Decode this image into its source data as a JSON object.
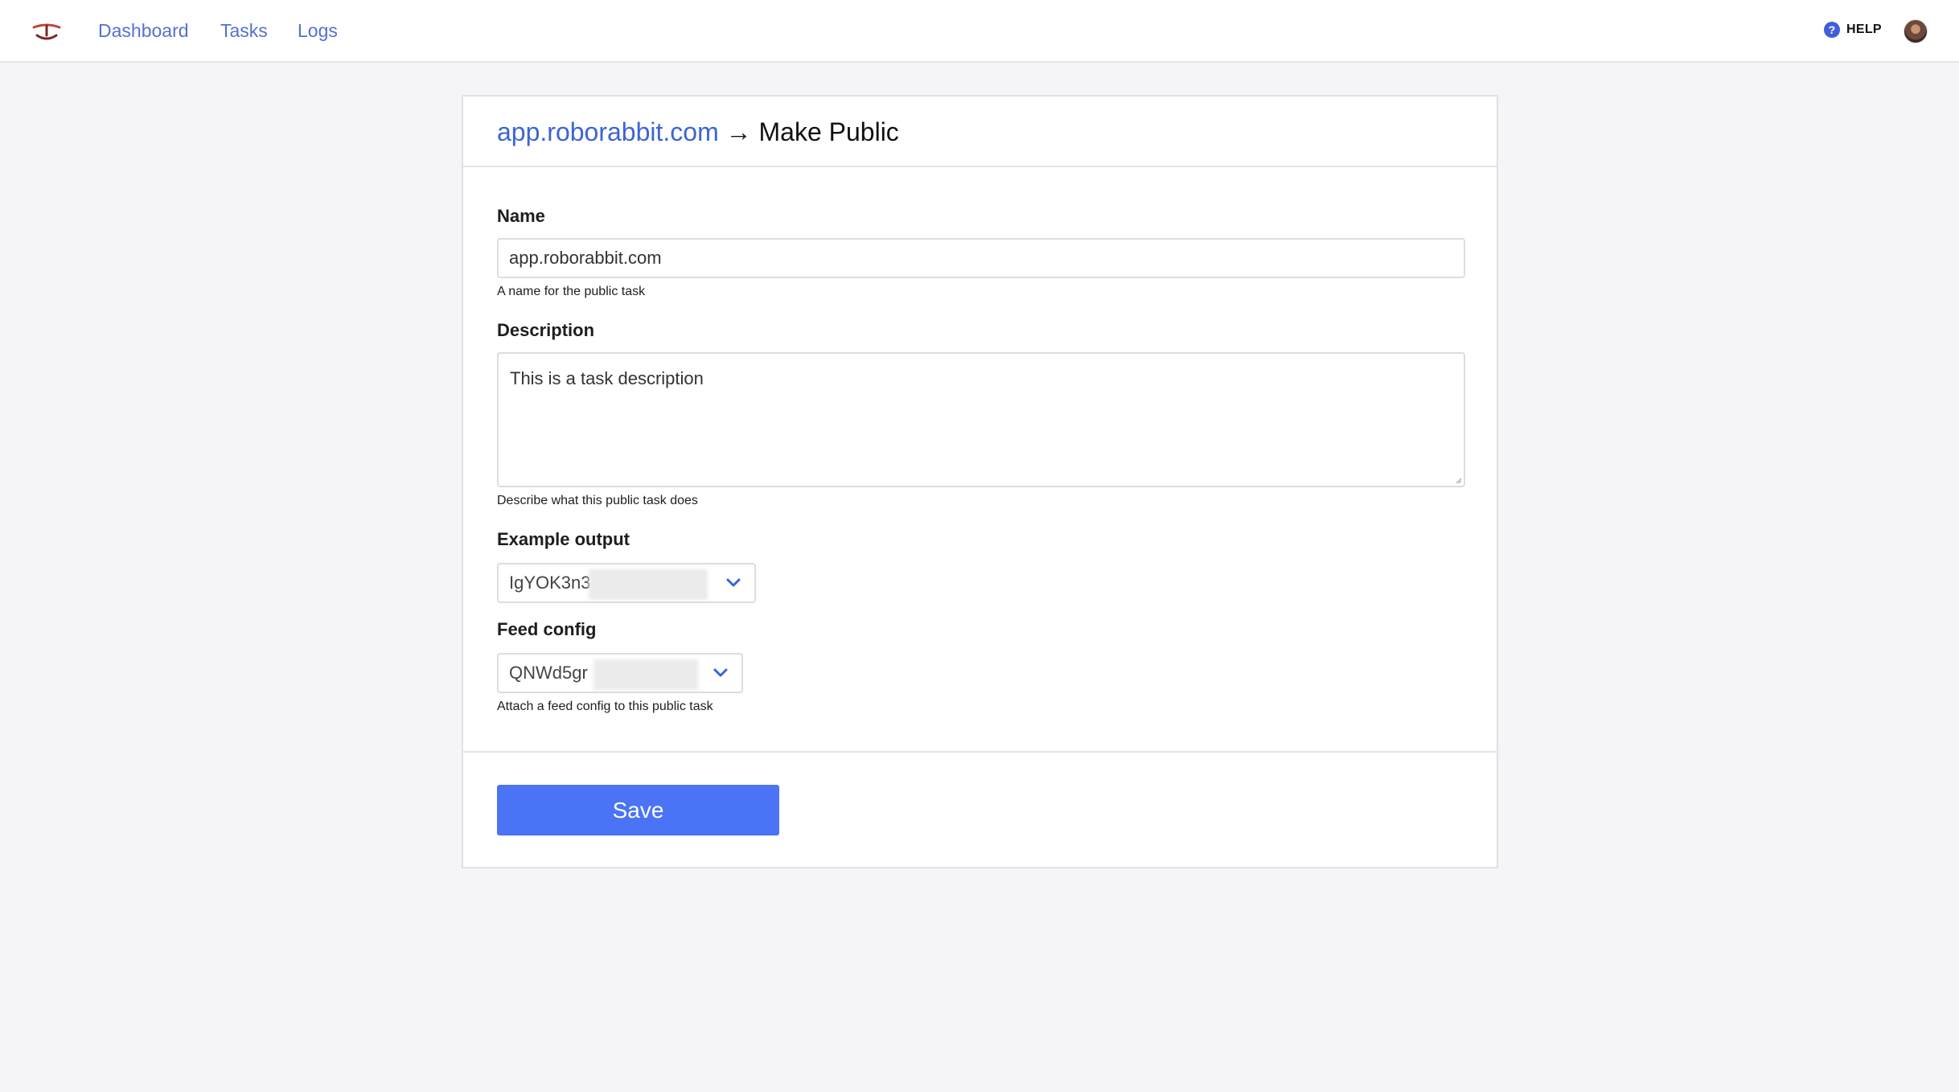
{
  "nav": {
    "logo_icon": "rabbit-logo-icon",
    "links": [
      {
        "label": "Dashboard"
      },
      {
        "label": "Tasks"
      },
      {
        "label": "Logs"
      }
    ],
    "help_label": "HELP",
    "help_icon": "question-circle-icon",
    "avatar_icon": "user-avatar"
  },
  "page": {
    "breadcrumb": "app.roborabbit.com",
    "arrow": "→",
    "title": "Make Public"
  },
  "form": {
    "name": {
      "label": "Name",
      "value": "app.roborabbit.com",
      "hint": "A name for the public task"
    },
    "description": {
      "label": "Description",
      "value": "This is a task description",
      "hint": "Describe what this public task does"
    },
    "example_output": {
      "label": "Example output",
      "selected": "IgYOK3n3"
    },
    "feed_config": {
      "label": "Feed config",
      "selected": "QNWd5gr",
      "hint": "Attach a feed config to this public task"
    },
    "save_label": "Save"
  },
  "colors": {
    "accent": "#4a73f5",
    "link": "#5470d0",
    "background": "#f5f5f7"
  }
}
